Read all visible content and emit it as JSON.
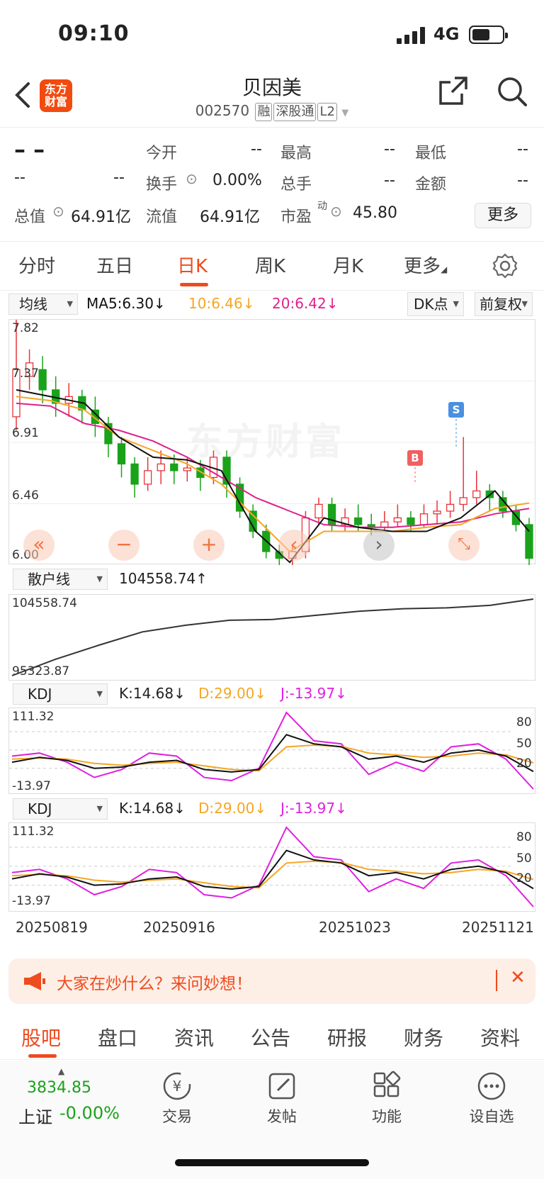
{
  "status_bar": {
    "time": "09:10",
    "network": "4G"
  },
  "header": {
    "back_icon": "chevron-left-icon",
    "logo_text": "东方\n财富",
    "title": "贝因美",
    "code": "002570",
    "tags": [
      "融",
      "深股通",
      "L2"
    ]
  },
  "quote": {
    "price": "– –",
    "change": "--",
    "change_pct": "--",
    "open_label": "今开",
    "open": "--",
    "high_label": "最高",
    "high": "--",
    "low_label": "最低",
    "low": "--",
    "turnover_rate_label": "换手",
    "turnover_rate": "0.00%",
    "volume_label": "总手",
    "volume": "--",
    "amount_label": "金额",
    "amount": "--",
    "total_value_label": "总值",
    "total_value": "64.91亿",
    "float_value_label": "流值",
    "float_value": "64.91亿",
    "pe_label": "市盈",
    "pe_sup": "动",
    "pe": "45.80",
    "more_button": "更多"
  },
  "period_tabs": [
    "分时",
    "五日",
    "日K",
    "周K",
    "月K",
    "更多"
  ],
  "active_period": "日K",
  "ma_bar": {
    "selector": "均线",
    "ma5": "MA5:6.30↓",
    "ma10": "10:6.46↓",
    "ma20": "20:6.42↓",
    "dk": "DK点",
    "adjust": "前复权"
  },
  "kline": {
    "y_labels": [
      "7.82",
      "7.37",
      "6.91",
      "6.46",
      "6.00"
    ],
    "markers": [
      "B",
      "S"
    ],
    "watermark": "东方财富"
  },
  "retail": {
    "selector": "散户线",
    "value": "104558.74↑",
    "max": "104558.74",
    "min": "95323.87"
  },
  "kdj1": {
    "selector": "KDJ",
    "k": "K:14.68↓",
    "d": "D:29.00↓",
    "j": "J:-13.97↓",
    "max": "111.32",
    "min": "-13.97",
    "levels": [
      "80",
      "50",
      "20"
    ]
  },
  "kdj2": {
    "selector": "KDJ",
    "k": "K:14.68↓",
    "d": "D:29.00↓",
    "j": "J:-13.97↓",
    "max": "111.32",
    "min": "-13.97",
    "levels": [
      "80",
      "50",
      "20"
    ]
  },
  "x_dates": [
    "20250819",
    "20250916",
    "20251023",
    "20251121"
  ],
  "banner": {
    "text": "大家在炒什么？来问妙想！"
  },
  "bottom_tabs": [
    "股吧",
    "盘口",
    "资讯",
    "公告",
    "研报",
    "财务",
    "资料"
  ],
  "bottom_bar": {
    "index_value": "3834.85",
    "index_name": "上证",
    "index_change": "-0.00%",
    "items": [
      "交易",
      "发帖",
      "功能",
      "设自选"
    ]
  },
  "colors": {
    "up": "#e8343a",
    "down": "#1aa21a",
    "accent": "#ee4b1e",
    "ma5": "#111111",
    "ma10": "#f5a623",
    "ma20": "#e0208a"
  },
  "chart_data": [
    {
      "type": "line",
      "title": "",
      "x": [
        "20250819",
        "20250916",
        "20251023",
        "20251121"
      ],
      "series": [
        {
          "name": "MA5",
          "values": [
            7.3,
            7.25,
            7.2,
            6.95,
            6.8,
            6.78,
            6.7,
            6.25,
            6.02,
            6.35,
            6.28,
            6.25,
            6.25,
            6.35,
            6.55,
            6.25
          ]
        },
        {
          "name": "10",
          "values": [
            7.25,
            7.22,
            7.15,
            6.95,
            6.85,
            6.75,
            6.6,
            6.35,
            6.1,
            6.25,
            6.25,
            6.25,
            6.28,
            6.3,
            6.42,
            6.46
          ]
        },
        {
          "name": "20",
          "values": [
            7.2,
            7.18,
            7.05,
            7.0,
            6.92,
            6.8,
            6.65,
            6.5,
            6.4,
            6.3,
            6.28,
            6.28,
            6.3,
            6.32,
            6.38,
            6.42
          ]
        }
      ],
      "ylim": [
        6.0,
        7.82
      ]
    },
    {
      "type": "line",
      "title": "",
      "series": [
        {
          "name": "散户线",
          "values": [
            95323.87,
            97300,
            99000,
            100600,
            101400,
            102000,
            102100,
            102600,
            103100,
            103400,
            103500,
            103800,
            104558.74
          ]
        }
      ],
      "ylim": [
        95323.87,
        104558.74
      ]
    },
    {
      "type": "line",
      "title": "",
      "series": [
        {
          "name": "K",
          "values": [
            30,
            38,
            33,
            20,
            22,
            30,
            33,
            18,
            14,
            18,
            75,
            60,
            55,
            35,
            40,
            30,
            45,
            50,
            40,
            14.68
          ]
        },
        {
          "name": "D",
          "values": [
            35,
            37,
            35,
            28,
            25,
            28,
            30,
            24,
            18,
            16,
            55,
            58,
            56,
            45,
            42,
            38,
            40,
            45,
            42,
            29.0
          ]
        },
        {
          "name": "J",
          "values": [
            40,
            45,
            30,
            5,
            18,
            45,
            40,
            5,
            0,
            20,
            111.32,
            65,
            60,
            10,
            30,
            15,
            55,
            60,
            35,
            -13.97
          ]
        }
      ],
      "ylim": [
        -13.97,
        111.32
      ]
    }
  ]
}
